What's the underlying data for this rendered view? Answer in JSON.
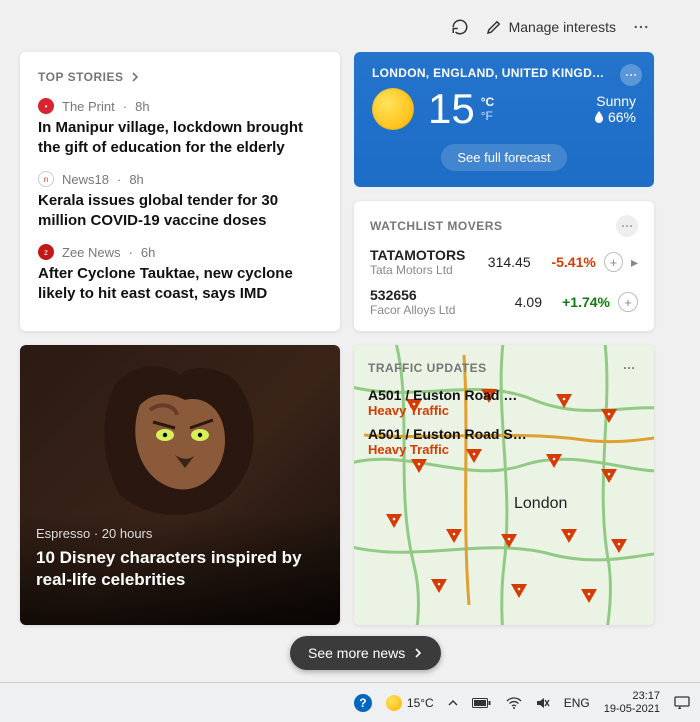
{
  "toolbar": {
    "manage_label": "Manage interests"
  },
  "top_stories": {
    "title": "TOP STORIES",
    "items": [
      {
        "source": "The Print",
        "age": "8h",
        "headline": "In Manipur village, lockdown brought the gift of education for the elderly",
        "color": "#d9232e"
      },
      {
        "source": "News18",
        "age": "8h",
        "headline": "Kerala issues global tender for 30 million COVID-19 vaccine doses",
        "color": "#e23b2a"
      },
      {
        "source": "Zee News",
        "age": "6h",
        "headline": "After Cyclone Tauktae, new cyclone likely to hit east coast, says IMD",
        "color": "#c21818"
      }
    ]
  },
  "weather": {
    "location": "LONDON, ENGLAND, UNITED KINGD…",
    "temp": "15",
    "unit_c": "°C",
    "unit_f": "°F",
    "condition": "Sunny",
    "humidity": "66%",
    "forecast_btn": "See full forecast"
  },
  "watchlist": {
    "title": "WATCHLIST MOVERS",
    "items": [
      {
        "symbol": "TATAMOTORS",
        "name": "Tata Motors Ltd",
        "price": "314.45",
        "change": "-5.41%",
        "dir": "neg"
      },
      {
        "symbol": "532656",
        "name": "Facor Alloys Ltd",
        "price": "4.09",
        "change": "+1.74%",
        "dir": "pos"
      }
    ]
  },
  "disney": {
    "source": "Espresso",
    "age": "20 hours",
    "headline": "10 Disney characters inspired by real-life celebrities"
  },
  "traffic": {
    "title": "TRAFFIC UPDATES",
    "items": [
      {
        "road": "A501 / Euston Road …",
        "status": "Heavy Traffic"
      },
      {
        "road": "A501 / Euston Road S…",
        "status": "Heavy Traffic"
      }
    ],
    "city": "London"
  },
  "see_more": "See more news",
  "taskbar": {
    "temp": "15°C",
    "lang": "ENG",
    "time": "23:17",
    "date": "19-05-2021"
  }
}
